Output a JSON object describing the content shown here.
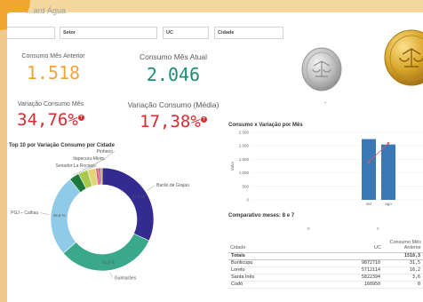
{
  "app": {
    "title": "...ard Água"
  },
  "filters": [
    {
      "label": ""
    },
    {
      "label": "Setor"
    },
    {
      "label": "UC"
    },
    {
      "label": "Cidade"
    }
  ],
  "kpis": {
    "consumo_anterior": {
      "label": "Consumo Mês Anterior",
      "value": "1.518"
    },
    "consumo_atual": {
      "label": "Consumo Mês Atual",
      "value": "2.046"
    },
    "variacao": {
      "label": "Variação Consumo Mês",
      "value": "34,76%"
    },
    "variacao_media": {
      "label": "Variação Consumo (Média)",
      "value": "17,38%"
    }
  },
  "indicator_placeholder": "-",
  "colors": {
    "accent_orange": "#f0a53c",
    "accent_green": "#1e8c73",
    "alert_red": "#d72b2e",
    "bar_blue": "#3a78b5",
    "frame": "#f3d79e"
  },
  "donut": {
    "title": "Top 10 por Variação Consumo por Cidade",
    "segments": [
      {
        "name": "Barão de Grajaú",
        "value": 31.8,
        "pct_label": "31.8 %",
        "color": "#332b8f"
      },
      {
        "name": "Guimarães",
        "value": 31.8,
        "pct_label": "31.8 %",
        "color": "#3aa88a"
      },
      {
        "name": "PGJ – Calhau",
        "value": 25.6,
        "pct_label": "25.6 %",
        "color": "#8fcbe8"
      },
      {
        "name": "Senador La Rocque",
        "value": 3.2,
        "pct_label": "",
        "color": "#1b7a3c"
      },
      {
        "name": "Itapecuru-Mirim",
        "value": 3.0,
        "pct_label": "",
        "color": "#a7c94e"
      },
      {
        "name": "Pinheiro",
        "value": 2.6,
        "pct_label": "",
        "color": "#e6d27a"
      },
      {
        "name": "",
        "value": 0.8,
        "pct_label": "",
        "color": "#e84e5c"
      },
      {
        "name": "",
        "value": 0.6,
        "pct_label": "",
        "color": "#7a3f8f"
      },
      {
        "name": "",
        "value": 0.6,
        "pct_label": "",
        "color": "#c48a3c"
      }
    ]
  },
  "chart_data": {
    "type": "bar",
    "title": "Consumo x Variação por Mês",
    "ylabel": "Valor",
    "xlabel": "",
    "categories": [
      "set",
      "ago"
    ],
    "ylim": [
      0,
      2500
    ],
    "yticks": [
      "2.500",
      "2.000",
      "1.500",
      "1.000",
      "500",
      "0"
    ],
    "series": [
      {
        "values": [
          2250,
          2050
        ],
        "kind": "bar"
      },
      {
        "values": [
          1400,
          2100
        ],
        "kind": "line"
      }
    ],
    "grid": true
  },
  "comparativo": {
    "title": "Comparativo meses: 8 e 7",
    "columns": [
      "Cidade",
      "UC",
      "Consumo Mês Anterior"
    ],
    "totals": {
      "label": "Totais",
      "uc": "",
      "value": "1518,3"
    },
    "rows": [
      {
        "cidade": "Buriticupu",
        "uc": "9872710",
        "valor": "31,5"
      },
      {
        "cidade": "Loreto",
        "uc": "5712114",
        "valor": "16,2"
      },
      {
        "cidade": "Santa Inês",
        "uc": "5822394",
        "valor": "3,6"
      },
      {
        "cidade": "Codó",
        "uc": "160950",
        "valor": "0"
      }
    ]
  }
}
